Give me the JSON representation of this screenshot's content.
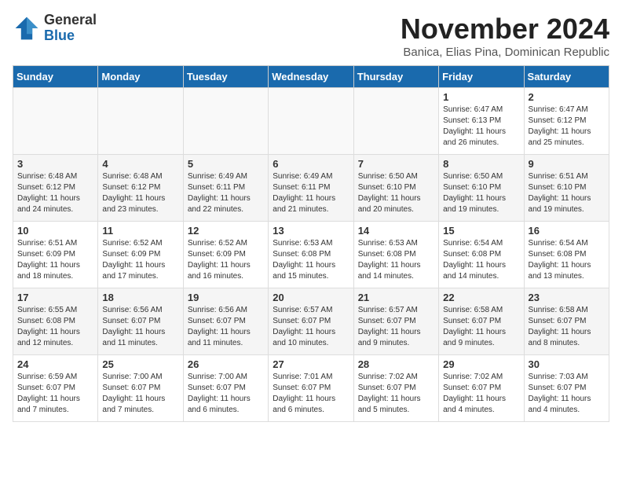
{
  "logo": {
    "text_general": "General",
    "text_blue": "Blue"
  },
  "header": {
    "month": "November 2024",
    "location": "Banica, Elias Pina, Dominican Republic"
  },
  "days_of_week": [
    "Sunday",
    "Monday",
    "Tuesday",
    "Wednesday",
    "Thursday",
    "Friday",
    "Saturday"
  ],
  "weeks": [
    [
      {
        "day": "",
        "info": ""
      },
      {
        "day": "",
        "info": ""
      },
      {
        "day": "",
        "info": ""
      },
      {
        "day": "",
        "info": ""
      },
      {
        "day": "",
        "info": ""
      },
      {
        "day": "1",
        "info": "Sunrise: 6:47 AM\nSunset: 6:13 PM\nDaylight: 11 hours and 26 minutes."
      },
      {
        "day": "2",
        "info": "Sunrise: 6:47 AM\nSunset: 6:12 PM\nDaylight: 11 hours and 25 minutes."
      }
    ],
    [
      {
        "day": "3",
        "info": "Sunrise: 6:48 AM\nSunset: 6:12 PM\nDaylight: 11 hours and 24 minutes."
      },
      {
        "day": "4",
        "info": "Sunrise: 6:48 AM\nSunset: 6:12 PM\nDaylight: 11 hours and 23 minutes."
      },
      {
        "day": "5",
        "info": "Sunrise: 6:49 AM\nSunset: 6:11 PM\nDaylight: 11 hours and 22 minutes."
      },
      {
        "day": "6",
        "info": "Sunrise: 6:49 AM\nSunset: 6:11 PM\nDaylight: 11 hours and 21 minutes."
      },
      {
        "day": "7",
        "info": "Sunrise: 6:50 AM\nSunset: 6:10 PM\nDaylight: 11 hours and 20 minutes."
      },
      {
        "day": "8",
        "info": "Sunrise: 6:50 AM\nSunset: 6:10 PM\nDaylight: 11 hours and 19 minutes."
      },
      {
        "day": "9",
        "info": "Sunrise: 6:51 AM\nSunset: 6:10 PM\nDaylight: 11 hours and 19 minutes."
      }
    ],
    [
      {
        "day": "10",
        "info": "Sunrise: 6:51 AM\nSunset: 6:09 PM\nDaylight: 11 hours and 18 minutes."
      },
      {
        "day": "11",
        "info": "Sunrise: 6:52 AM\nSunset: 6:09 PM\nDaylight: 11 hours and 17 minutes."
      },
      {
        "day": "12",
        "info": "Sunrise: 6:52 AM\nSunset: 6:09 PM\nDaylight: 11 hours and 16 minutes."
      },
      {
        "day": "13",
        "info": "Sunrise: 6:53 AM\nSunset: 6:08 PM\nDaylight: 11 hours and 15 minutes."
      },
      {
        "day": "14",
        "info": "Sunrise: 6:53 AM\nSunset: 6:08 PM\nDaylight: 11 hours and 14 minutes."
      },
      {
        "day": "15",
        "info": "Sunrise: 6:54 AM\nSunset: 6:08 PM\nDaylight: 11 hours and 14 minutes."
      },
      {
        "day": "16",
        "info": "Sunrise: 6:54 AM\nSunset: 6:08 PM\nDaylight: 11 hours and 13 minutes."
      }
    ],
    [
      {
        "day": "17",
        "info": "Sunrise: 6:55 AM\nSunset: 6:08 PM\nDaylight: 11 hours and 12 minutes."
      },
      {
        "day": "18",
        "info": "Sunrise: 6:56 AM\nSunset: 6:07 PM\nDaylight: 11 hours and 11 minutes."
      },
      {
        "day": "19",
        "info": "Sunrise: 6:56 AM\nSunset: 6:07 PM\nDaylight: 11 hours and 11 minutes."
      },
      {
        "day": "20",
        "info": "Sunrise: 6:57 AM\nSunset: 6:07 PM\nDaylight: 11 hours and 10 minutes."
      },
      {
        "day": "21",
        "info": "Sunrise: 6:57 AM\nSunset: 6:07 PM\nDaylight: 11 hours and 9 minutes."
      },
      {
        "day": "22",
        "info": "Sunrise: 6:58 AM\nSunset: 6:07 PM\nDaylight: 11 hours and 9 minutes."
      },
      {
        "day": "23",
        "info": "Sunrise: 6:58 AM\nSunset: 6:07 PM\nDaylight: 11 hours and 8 minutes."
      }
    ],
    [
      {
        "day": "24",
        "info": "Sunrise: 6:59 AM\nSunset: 6:07 PM\nDaylight: 11 hours and 7 minutes."
      },
      {
        "day": "25",
        "info": "Sunrise: 7:00 AM\nSunset: 6:07 PM\nDaylight: 11 hours and 7 minutes."
      },
      {
        "day": "26",
        "info": "Sunrise: 7:00 AM\nSunset: 6:07 PM\nDaylight: 11 hours and 6 minutes."
      },
      {
        "day": "27",
        "info": "Sunrise: 7:01 AM\nSunset: 6:07 PM\nDaylight: 11 hours and 6 minutes."
      },
      {
        "day": "28",
        "info": "Sunrise: 7:02 AM\nSunset: 6:07 PM\nDaylight: 11 hours and 5 minutes."
      },
      {
        "day": "29",
        "info": "Sunrise: 7:02 AM\nSunset: 6:07 PM\nDaylight: 11 hours and 4 minutes."
      },
      {
        "day": "30",
        "info": "Sunrise: 7:03 AM\nSunset: 6:07 PM\nDaylight: 11 hours and 4 minutes."
      }
    ]
  ]
}
